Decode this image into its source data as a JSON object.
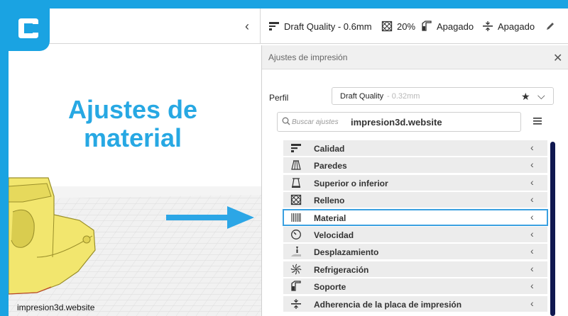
{
  "header": {
    "collapse_glyph": "‹",
    "quality": "Draft Quality - 0.6mm",
    "infill": "20%",
    "support": "Apagado",
    "adhesion": "Apagado"
  },
  "overlay": {
    "title_line1": "Ajustes de",
    "title_line2": "material"
  },
  "viewport": {
    "watermark": "impresion3d.website"
  },
  "panel": {
    "title": "Ajustes de impresión",
    "close_glyph": "✕",
    "profile_label": "Perfil",
    "profile_name": "Draft Quality",
    "profile_sub": "- 0.32mm",
    "search_placeholder": "Buscar ajustes",
    "search_watermark": "impresion3d.website",
    "categories": [
      {
        "label": "Calidad",
        "icon": "quality-icon"
      },
      {
        "label": "Paredes",
        "icon": "walls-icon"
      },
      {
        "label": "Superior o inferior",
        "icon": "top-bottom-icon"
      },
      {
        "label": "Relleno",
        "icon": "infill-icon"
      },
      {
        "label": "Material",
        "icon": "material-icon",
        "active": true
      },
      {
        "label": "Velocidad",
        "icon": "speed-icon"
      },
      {
        "label": "Desplazamiento",
        "icon": "travel-icon"
      },
      {
        "label": "Refrigeración",
        "icon": "cooling-icon"
      },
      {
        "label": "Soporte",
        "icon": "support-icon"
      },
      {
        "label": "Adherencia de la placa de impresión",
        "icon": "adhesion-icon"
      }
    ]
  },
  "colors": {
    "brand": "#1aa3e2",
    "overlay_text": "#27a8e3",
    "model": "#f2e66e",
    "scrollbar": "#101850",
    "active_outline": "#3aa0e0"
  }
}
